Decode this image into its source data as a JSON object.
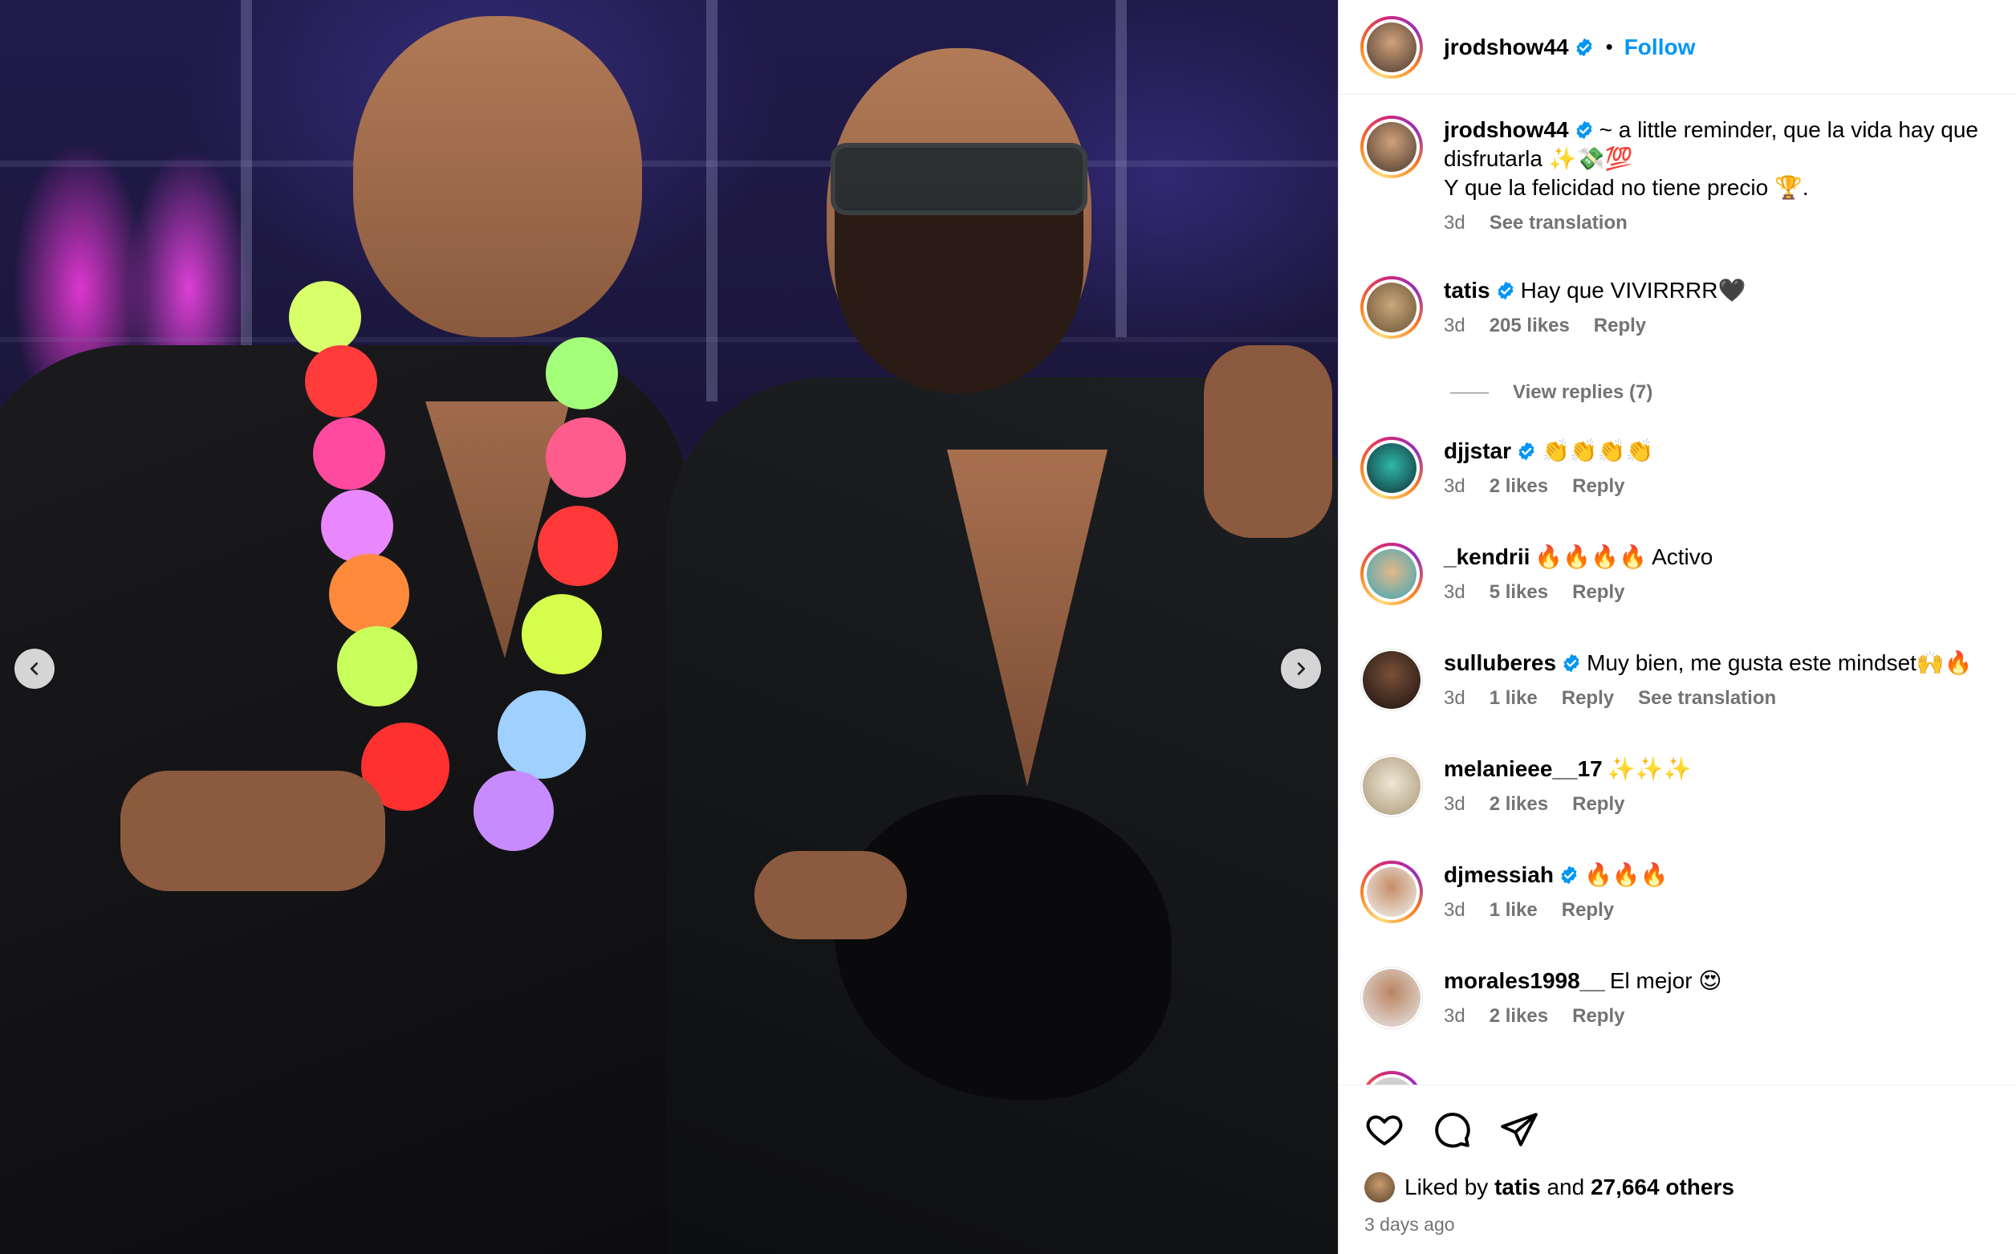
{
  "post": {
    "author": "jrodshow44",
    "follow_label": "Follow",
    "dot": "•"
  },
  "caption": {
    "username": "jrodshow44",
    "text_line1": "~ a little reminder, que la vida hay que disfrutarla ✨💸💯",
    "text_line2": "Y que la felicidad no tiene precio 🏆.",
    "time": "3d",
    "see_translation": "See translation"
  },
  "comments": [
    {
      "username": "tatis",
      "verified": true,
      "text": "Hay que VIVIRRRR🖤",
      "time": "3d",
      "likes": "205 likes",
      "reply": "Reply",
      "extra": ""
    },
    {
      "username": "djjstar",
      "verified": true,
      "text": "👏👏👏👏",
      "time": "3d",
      "likes": "2 likes",
      "reply": "Reply",
      "extra": ""
    },
    {
      "username": "_kendrii",
      "verified": false,
      "text": "🔥🔥🔥🔥 Activo",
      "time": "3d",
      "likes": "5 likes",
      "reply": "Reply",
      "extra": ""
    },
    {
      "username": "sulluberes",
      "verified": true,
      "text": "Muy bien, me gusta este mindset🙌🔥",
      "time": "3d",
      "likes": "1 like",
      "reply": "Reply",
      "extra": "See translation"
    },
    {
      "username": "melanieee__17",
      "verified": false,
      "text": "✨✨✨",
      "time": "3d",
      "likes": "2 likes",
      "reply": "Reply",
      "extra": ""
    },
    {
      "username": "djmessiah",
      "verified": true,
      "text": "🔥🔥🔥",
      "time": "3d",
      "likes": "1 like",
      "reply": "Reply",
      "extra": ""
    },
    {
      "username": "morales1998__",
      "verified": false,
      "text": "El mejor 😍",
      "time": "3d",
      "likes": "2 likes",
      "reply": "Reply",
      "extra": ""
    }
  ],
  "view_replies": "View replies (7)",
  "footer": {
    "liked_by_prefix": "Liked by",
    "liked_by_user": "tatis",
    "liked_by_and": "and",
    "liked_by_others": "27,664 others",
    "time_ago": "3 days ago"
  },
  "icons": {
    "prev": "chevron-left-icon",
    "next": "chevron-right-icon",
    "like": "heart-icon",
    "comment": "comment-icon",
    "share": "send-icon",
    "verified": "verified-badge-icon"
  },
  "colors": {
    "accent": "#0095f6",
    "muted": "#737373",
    "verified": "#0095f6"
  }
}
